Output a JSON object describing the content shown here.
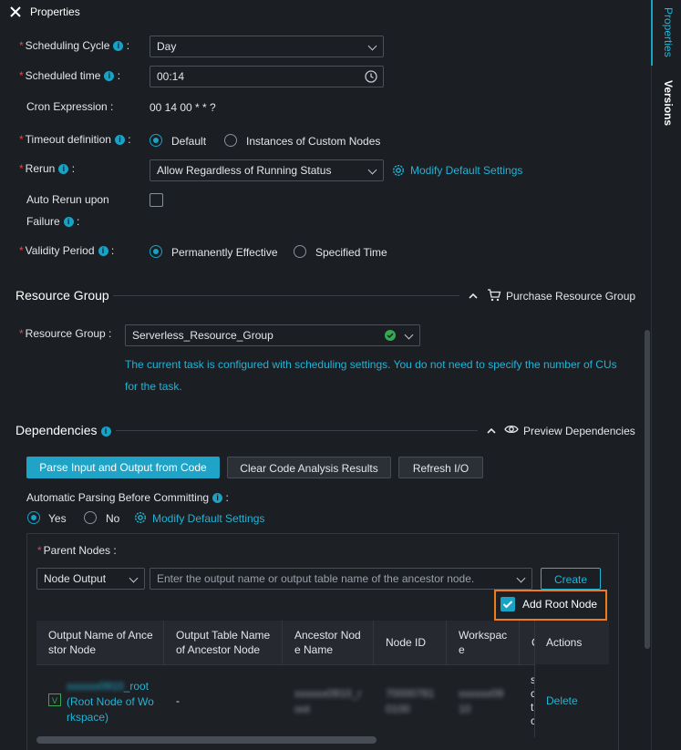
{
  "header": {
    "title": "Properties"
  },
  "schedule": {
    "cycle_label": "Scheduling Cycle",
    "cycle_value": "Day",
    "time_label": "Scheduled time",
    "time_value": "00:14",
    "cron_label": "Cron Expression :",
    "cron_value": "00 14 00 * * ?",
    "timeout_label": "Timeout definition",
    "timeout_options": [
      "Default",
      "Instances of Custom Nodes"
    ],
    "rerun_label": "Rerun",
    "rerun_value": "Allow Regardless of Running Status",
    "modify_default": "Modify Default Settings",
    "auto_rerun_label_1": "Auto Rerun upon",
    "auto_rerun_label_2": "Failure",
    "validity_label": "Validity Period",
    "validity_options": [
      "Permanently Effective",
      "Specified Time"
    ],
    "colon": ":"
  },
  "resource_group": {
    "section_title": "Resource Group",
    "purchase_label": "Purchase Resource Group",
    "label": "Resource Group :",
    "value": "Serverless_Resource_Group",
    "notice_1": "The current task is configured with scheduling settings. You do not need to specify the number of CUs",
    "notice_2": "for the task."
  },
  "dependencies": {
    "section_title": "Dependencies",
    "preview_label": "Preview Dependencies",
    "buttons": [
      "Parse Input and Output from Code",
      "Clear Code Analysis Results",
      "Refresh I/O"
    ],
    "auto_parse_label": "Automatic Parsing Before Committing",
    "auto_parse_options": [
      "Yes",
      "No"
    ],
    "modify_default": "Modify Default Settings",
    "parent_nodes_label": "Parent Nodes",
    "node_output_select": "Node Output",
    "search_placeholder": "Enter the output name or output table name of the ancestor node.",
    "create_button": "Create",
    "add_root_node": "Add Root Node",
    "table": {
      "headers": [
        "Output Name of Ancestor Node",
        "Output Table Name of Ancestor Node",
        "Ancestor Node Name",
        "Node ID",
        "Workspace",
        "C",
        "Actions"
      ],
      "header_lines": [
        [
          "Output Name of Ance",
          "stor Node"
        ],
        [
          "Output Table Name",
          "of Ancestor Node"
        ],
        [
          "Ancestor Nod",
          "e Name"
        ],
        [
          "Node ID",
          ""
        ],
        [
          "Workspac",
          "e"
        ],
        [
          "C",
          ""
        ],
        [
          "Actions",
          ""
        ]
      ],
      "row": {
        "badge": "V",
        "output_suffix": "_root",
        "output_line2": "(Root Node of Wo",
        "output_line3": "rkspace)",
        "table_name": "-",
        "truncated_col": "s c t c",
        "action": "Delete"
      }
    }
  },
  "sidebar": {
    "tabs": [
      "Properties",
      "Versions"
    ]
  },
  "colors": {
    "accent": "#17a2c6",
    "required": "#e64552",
    "highlight": "#f07b1d",
    "success": "#34a853"
  }
}
